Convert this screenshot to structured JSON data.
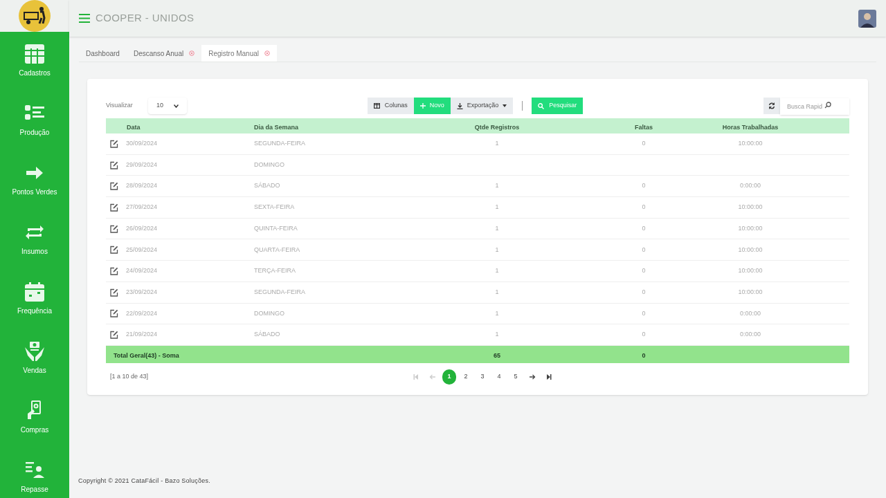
{
  "header": {
    "title": "COOPER - UNIDOS"
  },
  "sidebar": {
    "items": [
      {
        "label": "Cadastros"
      },
      {
        "label": "Produção"
      },
      {
        "label": "Pontos Verdes"
      },
      {
        "label": "Insumos"
      },
      {
        "label": "Frequência"
      },
      {
        "label": "Vendas"
      },
      {
        "label": "Compras"
      },
      {
        "label": "Repasse"
      }
    ]
  },
  "tabs": [
    {
      "label": "Dashboard",
      "closable": false,
      "selected": false
    },
    {
      "label": "Descanso Anual",
      "closable": true,
      "selected": false
    },
    {
      "label": "Registro Manual",
      "closable": true,
      "selected": true
    }
  ],
  "toolbar": {
    "page_size_label": "Visualizar",
    "page_size": "10",
    "columns_button": "Colunas",
    "new_button": "Novo",
    "export_button": "Exportação",
    "search_button": "Pesquisar",
    "quick_search_placeholder": "Busca Rapid"
  },
  "table": {
    "columns": [
      "Data",
      "Dia da Semana",
      "Qtde Registros",
      "Faltas",
      "Horas Trabalhadas"
    ],
    "rows": [
      [
        "30/09/2024",
        "SEGUNDA-FEIRA",
        "1",
        "0",
        "10:00:00"
      ],
      [
        "29/09/2024",
        "DOMINGO",
        "",
        "",
        ""
      ],
      [
        "28/09/2024",
        "SÁBADO",
        "1",
        "0",
        "0:00:00"
      ],
      [
        "27/09/2024",
        "SEXTA-FEIRA",
        "1",
        "0",
        "10:00:00"
      ],
      [
        "26/09/2024",
        "QUINTA-FEIRA",
        "1",
        "0",
        "10:00:00"
      ],
      [
        "25/09/2024",
        "QUARTA-FEIRA",
        "1",
        "0",
        "10:00:00"
      ],
      [
        "24/09/2024",
        "TERÇA-FEIRA",
        "1",
        "0",
        "10:00:00"
      ],
      [
        "23/09/2024",
        "SEGUNDA-FEIRA",
        "1",
        "0",
        "10:00:00"
      ],
      [
        "22/09/2024",
        "DOMINGO",
        "1",
        "0",
        "0:00:00"
      ],
      [
        "21/09/2024",
        "SÁBADO",
        "1",
        "0",
        "0:00:00"
      ]
    ],
    "footer": {
      "label": "Total Geral(43) - Soma",
      "qtde": "65",
      "faltas": "0"
    }
  },
  "pagination": {
    "info": "[1 a 10 de 43]",
    "pages": [
      {
        "label": "1",
        "selected": true
      },
      {
        "label": "2",
        "selected": false
      },
      {
        "label": "3",
        "selected": false
      },
      {
        "label": "4",
        "selected": false
      },
      {
        "label": "5",
        "selected": false
      }
    ]
  },
  "copyright": "Copyright © 2021 CataFácil - Bazo Soluções."
}
